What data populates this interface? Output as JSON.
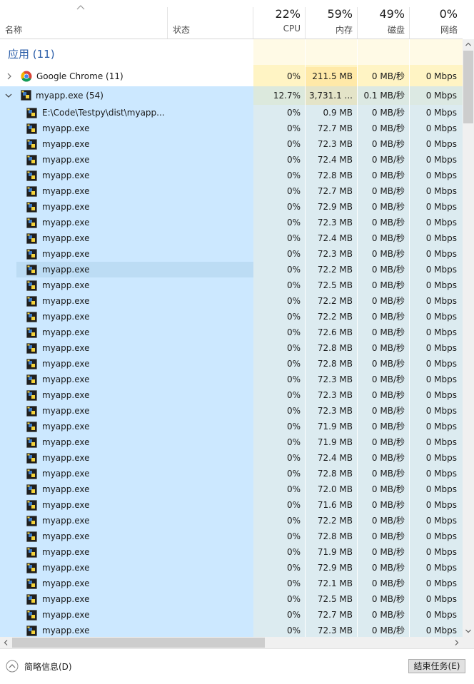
{
  "columns": {
    "name": "名称",
    "status": "状态",
    "cpu": {
      "pct": "22%",
      "label": "CPU"
    },
    "memory": {
      "pct": "59%",
      "label": "内存"
    },
    "disk": {
      "pct": "49%",
      "label": "磁盘"
    },
    "network": {
      "pct": "0%",
      "label": "网络"
    }
  },
  "group_title": "应用 (11)",
  "chrome": {
    "name": "Google Chrome (11)",
    "cpu": "0%",
    "memory": "211.5 MB",
    "disk": "0 MB/秒",
    "network": "0 Mbps"
  },
  "myapp": {
    "name": "myapp.exe (54)",
    "cpu": "12.7%",
    "memory": "3,731.1 ...",
    "disk": "0.1 MB/秒",
    "network": "0 Mbps"
  },
  "children": [
    {
      "name": "E:\\Code\\Testpy\\dist\\myapp...",
      "cpu": "0%",
      "memory": "0.9 MB",
      "disk": "0 MB/秒",
      "network": "0 Mbps"
    },
    {
      "name": "myapp.exe",
      "cpu": "0%",
      "memory": "72.7 MB",
      "disk": "0 MB/秒",
      "network": "0 Mbps"
    },
    {
      "name": "myapp.exe",
      "cpu": "0%",
      "memory": "72.3 MB",
      "disk": "0 MB/秒",
      "network": "0 Mbps"
    },
    {
      "name": "myapp.exe",
      "cpu": "0%",
      "memory": "72.4 MB",
      "disk": "0 MB/秒",
      "network": "0 Mbps"
    },
    {
      "name": "myapp.exe",
      "cpu": "0%",
      "memory": "72.8 MB",
      "disk": "0 MB/秒",
      "network": "0 Mbps"
    },
    {
      "name": "myapp.exe",
      "cpu": "0%",
      "memory": "72.7 MB",
      "disk": "0 MB/秒",
      "network": "0 Mbps"
    },
    {
      "name": "myapp.exe",
      "cpu": "0%",
      "memory": "72.9 MB",
      "disk": "0 MB/秒",
      "network": "0 Mbps"
    },
    {
      "name": "myapp.exe",
      "cpu": "0%",
      "memory": "72.3 MB",
      "disk": "0 MB/秒",
      "network": "0 Mbps"
    },
    {
      "name": "myapp.exe",
      "cpu": "0%",
      "memory": "72.4 MB",
      "disk": "0 MB/秒",
      "network": "0 Mbps"
    },
    {
      "name": "myapp.exe",
      "cpu": "0%",
      "memory": "72.3 MB",
      "disk": "0 MB/秒",
      "network": "0 Mbps"
    },
    {
      "name": "myapp.exe",
      "cpu": "0%",
      "memory": "72.2 MB",
      "disk": "0 MB/秒",
      "network": "0 Mbps",
      "selected": true
    },
    {
      "name": "myapp.exe",
      "cpu": "0%",
      "memory": "72.5 MB",
      "disk": "0 MB/秒",
      "network": "0 Mbps"
    },
    {
      "name": "myapp.exe",
      "cpu": "0%",
      "memory": "72.2 MB",
      "disk": "0 MB/秒",
      "network": "0 Mbps"
    },
    {
      "name": "myapp.exe",
      "cpu": "0%",
      "memory": "72.2 MB",
      "disk": "0 MB/秒",
      "network": "0 Mbps"
    },
    {
      "name": "myapp.exe",
      "cpu": "0%",
      "memory": "72.6 MB",
      "disk": "0 MB/秒",
      "network": "0 Mbps"
    },
    {
      "name": "myapp.exe",
      "cpu": "0%",
      "memory": "72.8 MB",
      "disk": "0 MB/秒",
      "network": "0 Mbps"
    },
    {
      "name": "myapp.exe",
      "cpu": "0%",
      "memory": "72.8 MB",
      "disk": "0 MB/秒",
      "network": "0 Mbps"
    },
    {
      "name": "myapp.exe",
      "cpu": "0%",
      "memory": "72.3 MB",
      "disk": "0 MB/秒",
      "network": "0 Mbps"
    },
    {
      "name": "myapp.exe",
      "cpu": "0%",
      "memory": "72.3 MB",
      "disk": "0 MB/秒",
      "network": "0 Mbps"
    },
    {
      "name": "myapp.exe",
      "cpu": "0%",
      "memory": "72.3 MB",
      "disk": "0 MB/秒",
      "network": "0 Mbps"
    },
    {
      "name": "myapp.exe",
      "cpu": "0%",
      "memory": "71.9 MB",
      "disk": "0 MB/秒",
      "network": "0 Mbps"
    },
    {
      "name": "myapp.exe",
      "cpu": "0%",
      "memory": "71.9 MB",
      "disk": "0 MB/秒",
      "network": "0 Mbps"
    },
    {
      "name": "myapp.exe",
      "cpu": "0%",
      "memory": "72.4 MB",
      "disk": "0 MB/秒",
      "network": "0 Mbps"
    },
    {
      "name": "myapp.exe",
      "cpu": "0%",
      "memory": "72.8 MB",
      "disk": "0 MB/秒",
      "network": "0 Mbps"
    },
    {
      "name": "myapp.exe",
      "cpu": "0%",
      "memory": "72.0 MB",
      "disk": "0 MB/秒",
      "network": "0 Mbps"
    },
    {
      "name": "myapp.exe",
      "cpu": "0%",
      "memory": "71.6 MB",
      "disk": "0 MB/秒",
      "network": "0 Mbps"
    },
    {
      "name": "myapp.exe",
      "cpu": "0%",
      "memory": "72.2 MB",
      "disk": "0 MB/秒",
      "network": "0 Mbps"
    },
    {
      "name": "myapp.exe",
      "cpu": "0%",
      "memory": "72.8 MB",
      "disk": "0 MB/秒",
      "network": "0 Mbps"
    },
    {
      "name": "myapp.exe",
      "cpu": "0%",
      "memory": "71.9 MB",
      "disk": "0 MB/秒",
      "network": "0 Mbps"
    },
    {
      "name": "myapp.exe",
      "cpu": "0%",
      "memory": "72.9 MB",
      "disk": "0 MB/秒",
      "network": "0 Mbps"
    },
    {
      "name": "myapp.exe",
      "cpu": "0%",
      "memory": "72.1 MB",
      "disk": "0 MB/秒",
      "network": "0 Mbps"
    },
    {
      "name": "myapp.exe",
      "cpu": "0%",
      "memory": "72.5 MB",
      "disk": "0 MB/秒",
      "network": "0 Mbps"
    },
    {
      "name": "myapp.exe",
      "cpu": "0%",
      "memory": "72.7 MB",
      "disk": "0 MB/秒",
      "network": "0 Mbps"
    },
    {
      "name": "myapp.exe",
      "cpu": "0%",
      "memory": "72.3 MB",
      "disk": "0 MB/秒",
      "network": "0 Mbps"
    }
  ],
  "footer": {
    "fewer_details": "简略信息(D)",
    "end_task": "结束任务(E)"
  },
  "colors": {
    "selection": "#cce8ff",
    "selected_row": "#bcdcf4",
    "group_title": "#2a5da8",
    "heat_yellow": "#fff4c4",
    "heat_yellow_strong": "#ffe9a8",
    "heat_light": "#fffae6"
  },
  "icons": {
    "app_icon": "python-exe-icon",
    "chrome_icon": "chrome-icon"
  }
}
